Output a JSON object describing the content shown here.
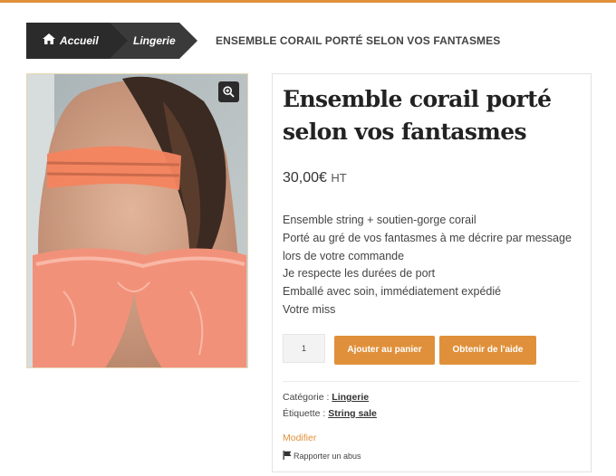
{
  "breadcrumb": {
    "home_label": "Accueil",
    "home_icon": "home-icon",
    "category_label": "Lingerie",
    "current_label": "ENSEMBLE CORAIL PORTÉ SELON VOS FANTASMES"
  },
  "product": {
    "image_zoom_icon": "zoom-in-icon",
    "title": "Ensemble corail porté selon vos fantasmes",
    "price": "30,00€",
    "price_suffix": "HT",
    "description_lines": [
      "Ensemble string + soutien-gorge corail",
      "Porté au gré de vos fantasmes à me décrire par message",
      "lors de votre commande",
      "Je respecte les durées de port",
      "Emballé avec soin, immédiatement expédié",
      "Votre miss"
    ],
    "quantity": "1",
    "add_to_cart_label": "Ajouter au panier",
    "help_label": "Obtenir de l'aide",
    "category_prefix": "Catégorie :",
    "category_value": "Lingerie",
    "tag_prefix": "Étiquette :",
    "tag_value": "String sale",
    "edit_label": "Modifier",
    "report_label": "Rapporter un abus",
    "report_icon": "flag-icon"
  },
  "colors": {
    "accent": "#e0903a",
    "breadcrumb_dark": "#2b2b2b"
  }
}
